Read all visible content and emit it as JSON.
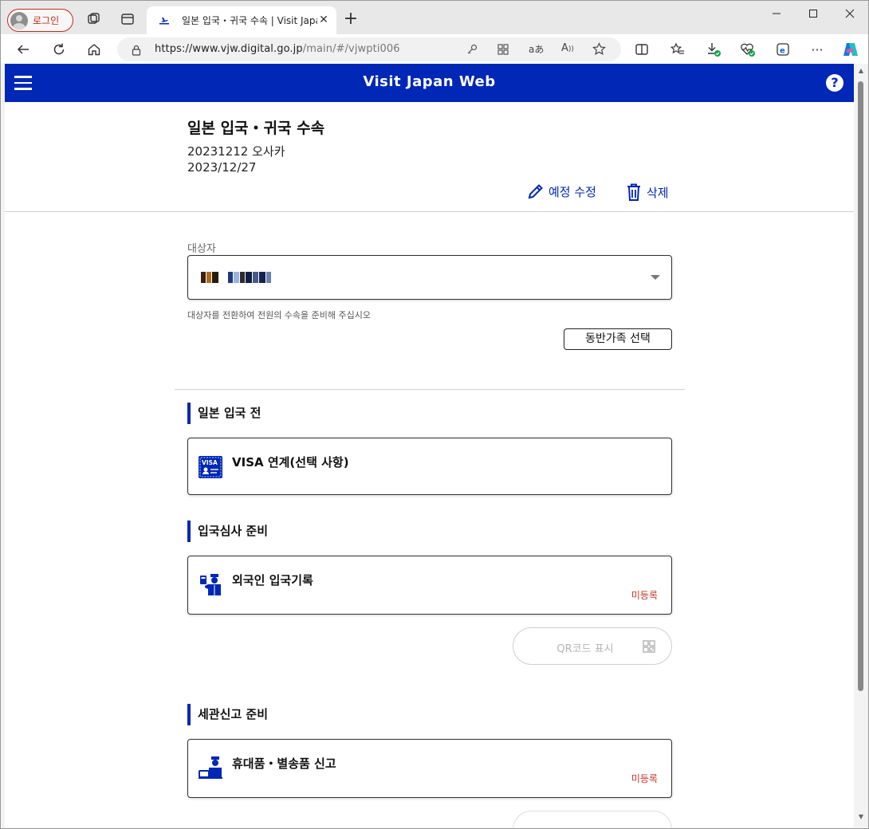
{
  "browser": {
    "profile_label": "로그인",
    "tab_title": "일본 입국・귀국 수속 | Visit Japan Web",
    "url_host": "https://www.vjw.digital.go.jp",
    "url_path": "/main/#/vjwpti006"
  },
  "header": {
    "brand": "Visit Japan Web",
    "help": "?"
  },
  "trip": {
    "title": "일본 입국・귀국 수속",
    "name": "20231212 오사카",
    "date": "2023/12/27",
    "edit_label": "예정 수정",
    "delete_label": "삭제"
  },
  "target": {
    "label": "대상자",
    "hint": "대상자를 전환하여 전원의 수속을 준비해 주십시오",
    "companion_button": "동반가족 선택"
  },
  "sections": {
    "before_entry": {
      "title": "일본 입국 전",
      "card_label": "VISA 연계(선택 사항)",
      "icon_text": "VISA"
    },
    "immigration": {
      "title": "입국심사 준비",
      "card_label": "외국인 입국기록",
      "status": "미등록",
      "qr_label": "QR코드 표시"
    },
    "customs": {
      "title": "세관신고 준비",
      "card_label": "휴대품・별송품 신고",
      "status": "미등록"
    }
  },
  "colors": {
    "brand": "#0027b5",
    "status_unregistered": "#c0392b"
  }
}
